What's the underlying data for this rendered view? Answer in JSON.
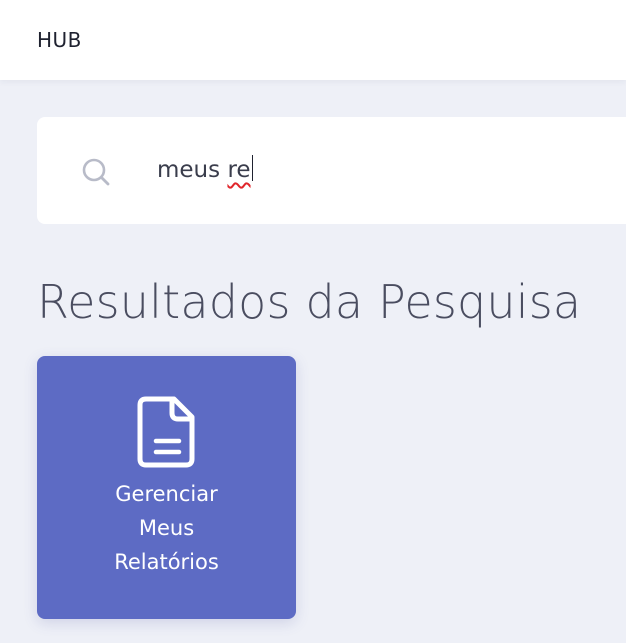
{
  "header": {
    "brand": "HUB"
  },
  "search": {
    "value_plain": "meus ",
    "value_misspelled": "re",
    "icon": "search-icon"
  },
  "results": {
    "title": "Resultados da Pesquisa",
    "cards": [
      {
        "icon": "document-icon",
        "label_lines": [
          "Gerenciar",
          "Meus",
          "Relatórios"
        ],
        "background": "#5d6bc4"
      }
    ]
  },
  "colors": {
    "page_background": "#eef0f7",
    "card_accent": "#5d6bc4",
    "spellcheck_underline": "#e0262b"
  }
}
